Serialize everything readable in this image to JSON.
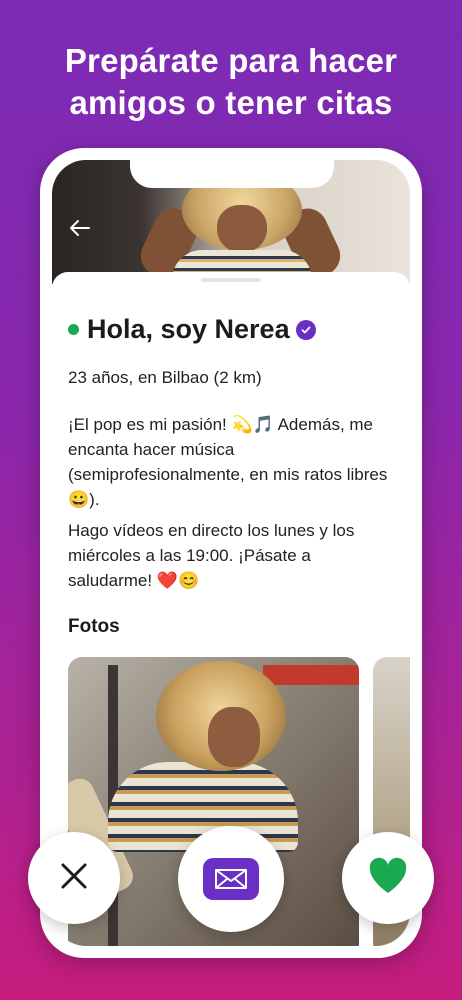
{
  "promo": {
    "headline_line1": "Prepárate para hacer",
    "headline_line2": "amigos o tener citas"
  },
  "profile": {
    "name": "Hola, soy Nerea",
    "meta": "23 años, en Bilbao (2 km)",
    "bio_1": "¡El pop es mi pasión! 💫🎵 Además, me encanta hacer música (semiprofesionalmente, en mis ratos libres 😀).",
    "bio_2": "Hago vídeos en directo los lunes y los miércoles a las 19:00. ¡Pásate a saludarme! ❤️😊",
    "photos_title": "Fotos",
    "online": true,
    "verified": true
  },
  "icons": {
    "back": "arrow-left-icon",
    "verified": "verified-check-icon",
    "close": "close-icon",
    "message": "envelope-icon",
    "like": "heart-icon"
  },
  "colors": {
    "brand_purple": "#6a2fc4",
    "online_green": "#1aa851",
    "like_green": "#1aa851",
    "gradient_top": "#7b2bb5",
    "gradient_bottom": "#c61d7e"
  }
}
